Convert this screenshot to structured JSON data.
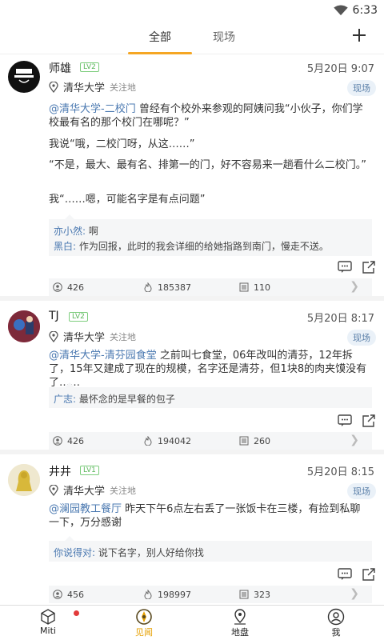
{
  "status": {
    "time": "6:33"
  },
  "tabs": {
    "all": "全部",
    "live": "现场"
  },
  "posts": [
    {
      "username": "师雄",
      "level": "LV2",
      "time": "5月20日 9:07",
      "location": "清华大学",
      "follow": "关注地",
      "tag": "现场",
      "link": "@清华大学-二校门",
      "text1": " 曾经有个校外来参观的阿姨问我“小伙子，你们学校最有名的那个校门在哪呢？”",
      "text2": "我说“哦，二校门呀，从这……”",
      "text3": "“不是，最大、最有名、排第一的门，好不容易来一趟看什么二校门。”",
      "text4": "我“……嗯，可能名字是有点问题”",
      "comments": [
        {
          "name": "亦小然:",
          "text": " 啊"
        },
        {
          "name": "黑白:",
          "text": " 作为回报，此时的我会详细的给她指路到南门，慢走不送。"
        }
      ],
      "stats": [
        "426",
        "185387",
        "110"
      ]
    },
    {
      "username": "TJ",
      "level": "LV2",
      "time": "5月20日 8:17",
      "location": "清华大学",
      "follow": "关注地",
      "tag": "现场",
      "link": "@清华大学-清芬园食堂",
      "text1": " 之前叫七食堂，06年改叫的清芬，12年拆了，15年又建成了现在的规模，名字还是清芬，但1块8的肉夹馍没有了……",
      "comments": [
        {
          "name": "广志:",
          "text": " 最怀念的是早餐的包子"
        }
      ],
      "stats": [
        "426",
        "194042",
        "260"
      ]
    },
    {
      "username": "井井",
      "level": "LV1",
      "time": "5月20日 8:15",
      "location": "清华大学",
      "follow": "关注地",
      "tag": "现场",
      "link": "@澜园教工餐厅",
      "text1": " 昨天下午6点左右丢了一张饭卡在三楼，有捡到私聊一下，万分感谢",
      "comments": [
        {
          "name": "你说得对:",
          "text": " 说下名字，别人好给你找"
        }
      ],
      "stats": [
        "456",
        "198997",
        "323"
      ]
    }
  ],
  "nav": {
    "miti": "Miti",
    "jianwen": "见闻",
    "dipan": "地盘",
    "me": "我"
  },
  "colors": {
    "accent": "#f5a623",
    "link": "#4a78b0",
    "level": "#5bb65b",
    "badge": "#e23a3a"
  }
}
